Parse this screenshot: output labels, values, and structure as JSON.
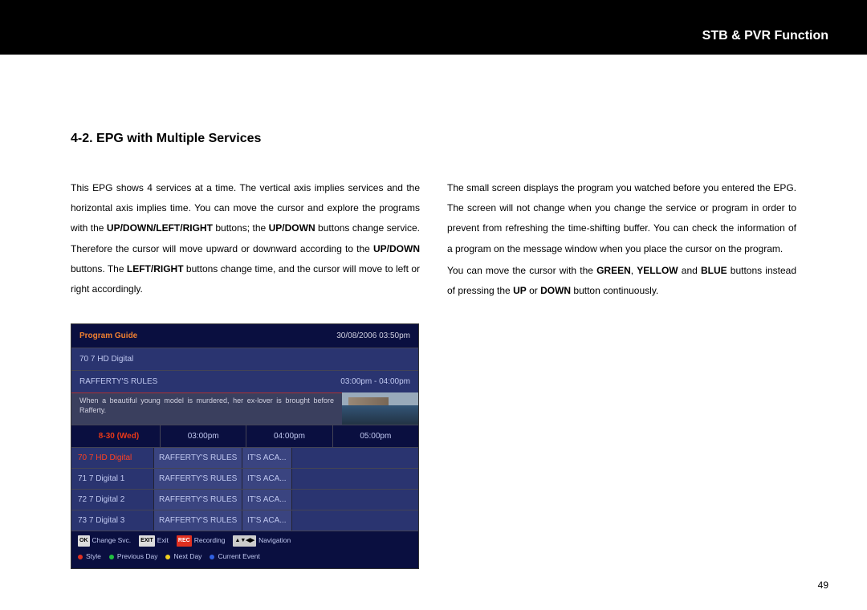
{
  "header": {
    "title": "STB & PVR Function"
  },
  "section": {
    "title": "4-2. EPG with Multiple Services"
  },
  "para": {
    "left_1": "This EPG shows 4 services at a time. The vertical axis implies services and the horizontal axis implies time. You can move the cursor and explore the programs with the ",
    "b1": "UP/DOWN/LEFT/RIGHT",
    "left_2": " buttons; the ",
    "b2": "UP/DOWN",
    "left_3": " buttons change service. Therefore the cursor will move upward or downward according to the ",
    "b3": "UP/DOWN",
    "left_4": " buttons. The ",
    "b4": "LEFT/RIGHT",
    "left_5": " buttons change time, and the cursor will move to left or right accordingly.",
    "right_1": "The small screen displays the program you watched before you entered the EPG. The screen will not change when you change the service or program in order to prevent from refreshing the time-shifting buffer. You can check the information of a program on the message window when you place the cursor on the program.",
    "right_2a": "You can move the cursor with the ",
    "rb1": "GREEN",
    "right_2b": ", ",
    "rb2": "YELLOW",
    "right_2c": " and ",
    "rb3": "BLUE",
    "right_2d": " buttons instead of pressing the ",
    "rb4": "UP",
    "right_2e": " or ",
    "rb5": "DOWN",
    "right_2f": " button continuously."
  },
  "epg": {
    "title": "Program Guide",
    "datetime": "30/08/2006   03:50pm",
    "current_service": "70  7 HD Digital",
    "current_program": "RAFFERTY'S RULES",
    "current_time": "03:00pm - 04:00pm",
    "description": "When a beautiful young model is murdered, her ex-lover is brought before Rafferty.",
    "grid_date": "8-30 (Wed)",
    "times": [
      "03:00pm",
      "04:00pm",
      "05:00pm"
    ],
    "rows": [
      {
        "svc": "70 7 HD Digital",
        "c1": "RAFFERTY'S RULES",
        "c2": "IT'S ACA...",
        "selected": true
      },
      {
        "svc": "71 7 Digital 1",
        "c1": "RAFFERTY'S RULES",
        "c2": "IT'S ACA..."
      },
      {
        "svc": "72 7 Digital 2",
        "c1": "RAFFERTY'S RULES",
        "c2": "IT'S ACA..."
      },
      {
        "svc": "73 7 Digital 3",
        "c1": "RAFFERTY'S RULES",
        "c2": "IT'S ACA..."
      }
    ],
    "footer": {
      "ok": "OK",
      "change_svc": "Change Svc.",
      "exit": "EXIT",
      "exit_label": "Exit",
      "rec": "REC",
      "recording": "Recording",
      "nav": "▲▼◀▶",
      "navigation": "Navigation",
      "style": "Style",
      "prev": "Previous Day",
      "next": "Next Day",
      "current": "Current Event"
    }
  },
  "page_number": "49"
}
